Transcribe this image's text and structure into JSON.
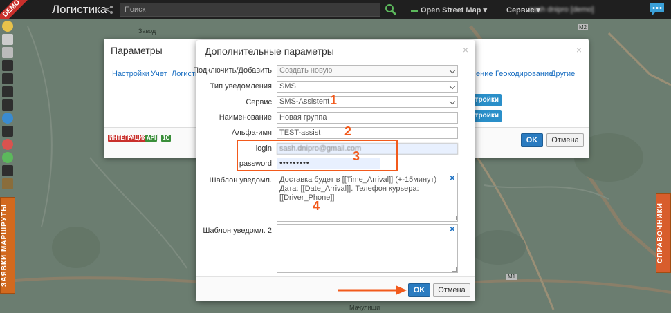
{
  "topbar": {
    "demo_label": "DEMO",
    "app_title": "Логистика",
    "search_placeholder": "Поиск",
    "map_provider": "Open Street Map",
    "service_menu": "Сервис",
    "user_menu": "sash dnipro [demo]"
  },
  "map_labels": {
    "top": "Завод",
    "m2": "M2",
    "m1": "M1",
    "bottom": "Мачулищи"
  },
  "side_tabs": {
    "left": "ЗАЯВКИ  МАРШРУТЫ",
    "right": "СПРАВОЧНИКИ"
  },
  "bg_modal": {
    "title": "Параметры",
    "tabs": [
      "Настройки",
      "Учет",
      "Логисти",
      "ение",
      "Геокодирование",
      "Другие"
    ],
    "btn1": "тройки",
    "btn2": "тройки",
    "badges": [
      "ИНТЕГРАЦИЯ",
      "API",
      "1С"
    ],
    "ok_label": "OK",
    "cancel_label": "Отмена"
  },
  "modal": {
    "title": "Дополнительные параметры",
    "fields": {
      "connect_label": "Подключить/Добавить",
      "connect_value": "Создать новую",
      "notif_type_label": "Тип уведомления",
      "notif_type_value": "SMS",
      "service_label": "Сервис",
      "service_value": "SMS-Assistent",
      "name_label": "Наименование",
      "name_value": "Новая группа",
      "alpha_label": "Альфа-имя",
      "alpha_value": "TEST-assist",
      "login_label": "login",
      "login_value": "sash.dnipro@gmail.com",
      "password_label": "password",
      "password_value": "•••••••••",
      "template_label": "Шаблон уведомл.",
      "template_value": "Доставка будет в [[Time_Arrival]] (+-15минут) Дата: [[Date_Arrival]]. Телефон курьера: [[Driver_Phone]]",
      "template2_label": "Шаблон уведомл. 2",
      "template2_value": ""
    },
    "ok_label": "OK",
    "cancel_label": "Отмена"
  },
  "annotations": [
    "1",
    "2",
    "3",
    "4"
  ],
  "colors": {
    "accent": "#2a7bc0",
    "annotation": "#f25a1c",
    "link": "#1a6fc2"
  }
}
